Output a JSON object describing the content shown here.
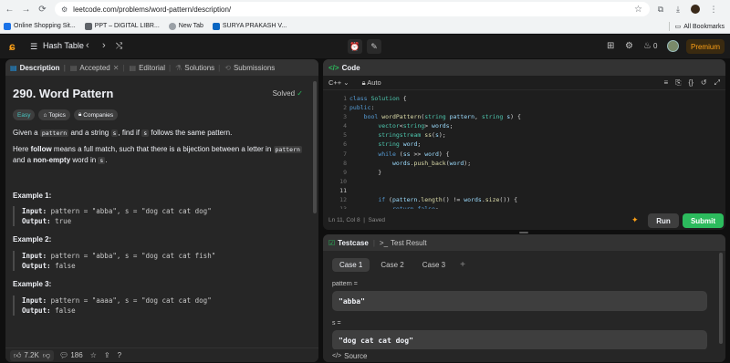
{
  "browser": {
    "url": "leetcode.com/problems/word-pattern/description/",
    "bookmarks": [
      {
        "label": "Online Shopping Sit...",
        "color": "#1a73e8"
      },
      {
        "label": "PPT – DIGITAL LIBR...",
        "color": "#5f6368"
      },
      {
        "label": "New Tab",
        "color": "#5f6368"
      },
      {
        "label": "SURYA PRAKASH V...",
        "color": "#0a66c2"
      }
    ],
    "all_bookmarks": "All Bookmarks"
  },
  "nav": {
    "problem_list": "Hash Table",
    "streak_count": "0",
    "premium": "Premium"
  },
  "left_tabs": {
    "description": "Description",
    "accepted": "Accepted",
    "editorial": "Editorial",
    "solutions": "Solutions",
    "submissions": "Submissions"
  },
  "problem": {
    "title": "290. Word Pattern",
    "status": "Solved",
    "tags": [
      "Easy",
      "Topics",
      "Companies"
    ],
    "intro_1": "Given a",
    "intro_code_1": "pattern",
    "intro_2": "and a string",
    "intro_code_2": "s",
    "intro_3": ", find if",
    "intro_code_3": "s",
    "intro_4": "follows the same pattern.",
    "here_1": "Here",
    "here_follow": "follow",
    "here_2": "means a full match, such that there is a bijection between a letter in",
    "here_code_1": "pattern",
    "here_3": "and a",
    "here_nonempty": "non-empty",
    "here_4": "word in",
    "here_code_2": "s",
    "here_5": ".",
    "examples": [
      {
        "heading": "Example 1:",
        "input_label": "Input:",
        "input": "pattern = \"abba\", s = \"dog cat cat dog\"",
        "output_label": "Output:",
        "output": "true"
      },
      {
        "heading": "Example 2:",
        "input_label": "Input:",
        "input": "pattern = \"abba\", s = \"dog cat cat fish\"",
        "output_label": "Output:",
        "output": "false"
      },
      {
        "heading": "Example 3:",
        "input_label": "Input:",
        "input": "pattern = \"aaaa\", s = \"dog cat cat dog\"",
        "output_label": "Output:",
        "output": "false"
      }
    ],
    "likes": "7.2K",
    "comments": "186"
  },
  "code_panel": {
    "header": "Code",
    "language": "C++",
    "mode": "Auto",
    "line_numbers": [
      "10",
      "1",
      "2",
      "3",
      "4",
      "5",
      "6",
      "7",
      "8",
      "9",
      "10",
      "11",
      "12",
      "13"
    ],
    "current_line": "11",
    "status": "Ln 11, Col 8",
    "saved": "Saved",
    "run": "Run",
    "submit": "Submit"
  },
  "testcase": {
    "tab_testcase": "Testcase",
    "tab_result": "Test Result",
    "cases": [
      "Case 1",
      "Case 2",
      "Case 3"
    ],
    "param1_label": "pattern =",
    "param1_value": "\"abba\"",
    "param2_label": "s =",
    "param2_value": "\"dog cat cat dog\"",
    "source": "Source"
  },
  "colors": {
    "accent_green": "#2cbb5d",
    "accent_orange": "#ffa116",
    "easy_teal": "#46c6c2"
  }
}
